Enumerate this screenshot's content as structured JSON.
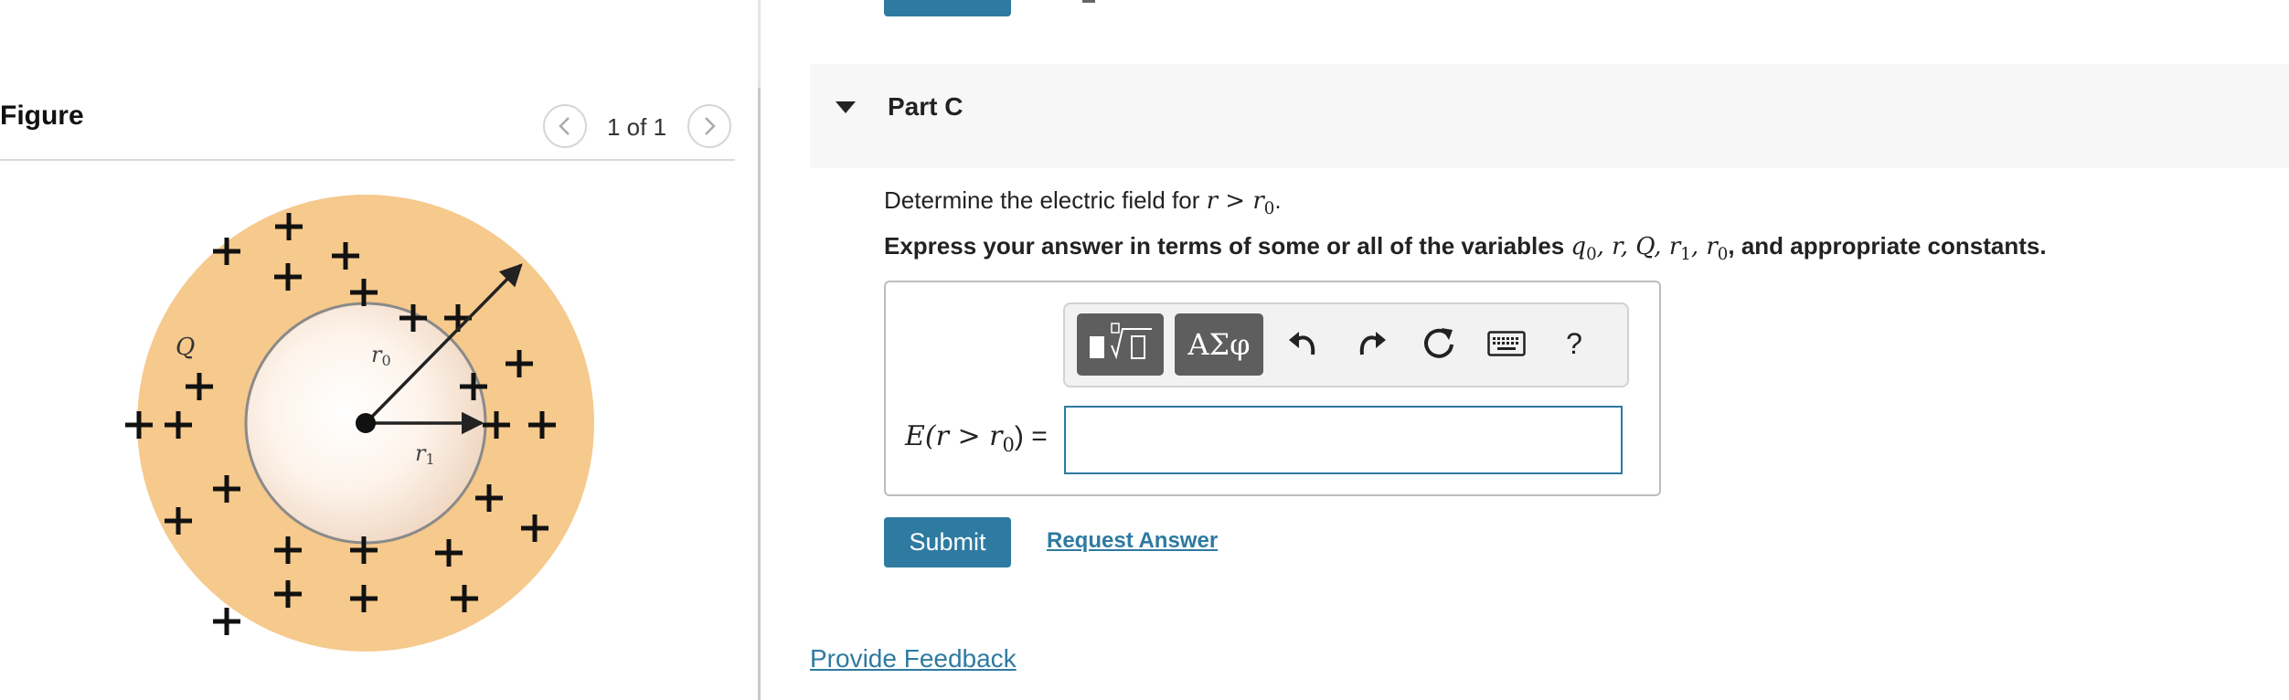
{
  "figure_panel": {
    "title": "Figure",
    "pager": "1 of 1",
    "diagram_labels": {
      "charge": "Q",
      "r0": "r0",
      "r1": "r1"
    }
  },
  "part": {
    "title": "Part C",
    "question_prefix": "Determine the electric field for",
    "question_condition": "r > r",
    "question_condition_sub": "0",
    "question_suffix": ".",
    "instructions_prefix": "Express your answer in terms of some or all of the variables",
    "instructions_vars": [
      "q0",
      "r",
      "Q",
      "r1",
      "r0"
    ],
    "instructions_suffix": ", and appropriate constants."
  },
  "toolbar": {
    "symbols_label": "ΑΣφ",
    "help_label": "?"
  },
  "answer": {
    "label_fn": "E(r > r",
    "label_sub": "0",
    "label_tail": ") =",
    "value": ""
  },
  "actions": {
    "submit_label": "Submit",
    "request_label": "Request Answer",
    "feedback_label": "Provide Feedback"
  },
  "colors": {
    "accent": "#2f7aa1",
    "sphere_fill": "#f6c98c",
    "header_bg": "#f7f7f7"
  },
  "icons": [
    "chevron-left-icon",
    "chevron-right-icon",
    "caret-down-icon",
    "templates-icon",
    "undo-icon",
    "redo-icon",
    "reset-icon",
    "keyboard-icon",
    "help-icon"
  ]
}
